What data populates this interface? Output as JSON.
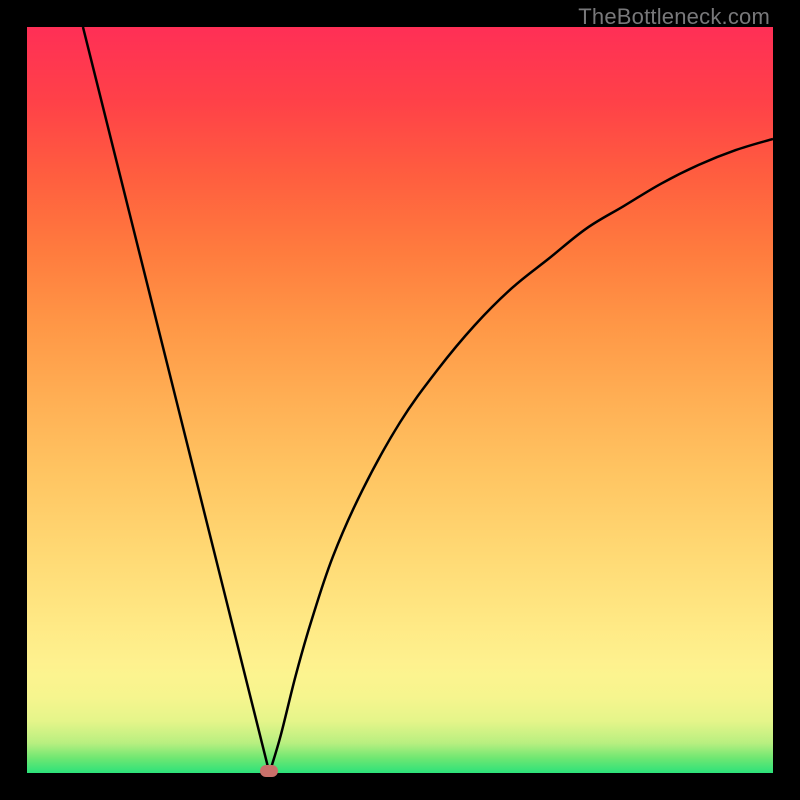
{
  "watermark": "TheBottleneck.com",
  "colors": {
    "curve": "#000000",
    "marker": "#c9706a"
  },
  "chart_data": {
    "type": "line",
    "title": "",
    "xlabel": "",
    "ylabel": "",
    "xlim": [
      0,
      100
    ],
    "ylim": [
      0,
      100
    ],
    "min_point": {
      "x": 32.5,
      "y": 0
    },
    "left_branch": [
      {
        "x": 7.5,
        "y": 100
      },
      {
        "x": 10,
        "y": 90
      },
      {
        "x": 12.5,
        "y": 80
      },
      {
        "x": 15,
        "y": 70
      },
      {
        "x": 17.5,
        "y": 60
      },
      {
        "x": 20,
        "y": 50
      },
      {
        "x": 22.5,
        "y": 40
      },
      {
        "x": 25,
        "y": 30
      },
      {
        "x": 27.5,
        "y": 20
      },
      {
        "x": 30,
        "y": 10
      },
      {
        "x": 31.5,
        "y": 4
      },
      {
        "x": 32.5,
        "y": 0
      }
    ],
    "right_branch": [
      {
        "x": 32.5,
        "y": 0
      },
      {
        "x": 34,
        "y": 5
      },
      {
        "x": 36,
        "y": 13
      },
      {
        "x": 38,
        "y": 20
      },
      {
        "x": 41,
        "y": 29
      },
      {
        "x": 45,
        "y": 38
      },
      {
        "x": 50,
        "y": 47
      },
      {
        "x": 55,
        "y": 54
      },
      {
        "x": 60,
        "y": 60
      },
      {
        "x": 65,
        "y": 65
      },
      {
        "x": 70,
        "y": 69
      },
      {
        "x": 75,
        "y": 73
      },
      {
        "x": 80,
        "y": 76
      },
      {
        "x": 85,
        "y": 79
      },
      {
        "x": 90,
        "y": 81.5
      },
      {
        "x": 95,
        "y": 83.5
      },
      {
        "x": 100,
        "y": 85
      }
    ]
  }
}
